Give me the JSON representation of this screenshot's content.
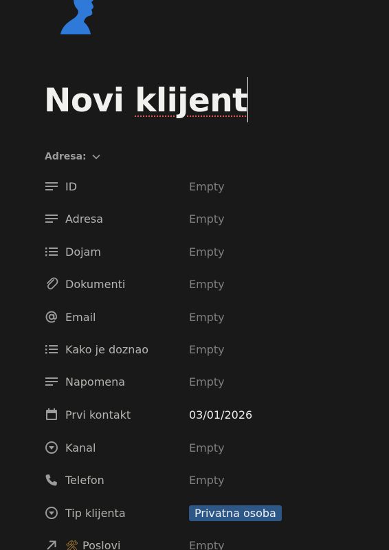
{
  "page": {
    "title_part1": "Novi ",
    "title_part2": "klijent"
  },
  "section": {
    "label": "Adresa:",
    "toggle_icon": "chevron-down-icon"
  },
  "properties": [
    {
      "label": "ID",
      "value": "Empty",
      "icon": "text-lines-icon"
    },
    {
      "label": "Adresa",
      "value": "Empty",
      "icon": "text-lines-icon"
    },
    {
      "label": "Dojam",
      "value": "Empty",
      "icon": "list-icon"
    },
    {
      "label": "Dokumenti",
      "value": "Empty",
      "icon": "paperclip-icon"
    },
    {
      "label": "Email",
      "value": "Empty",
      "icon": "at-icon"
    },
    {
      "label": "Kako je doznao",
      "value": "Empty",
      "icon": "list-icon"
    },
    {
      "label": "Napomena",
      "value": "Empty",
      "icon": "text-lines-icon"
    },
    {
      "label": "Prvi kontakt",
      "value": "03/01/2026",
      "icon": "calendar-icon"
    },
    {
      "label": "Kanal",
      "value": "Empty",
      "icon": "select-icon"
    },
    {
      "label": "Telefon",
      "value": "Empty",
      "icon": "phone-icon"
    },
    {
      "label": "Tip klijenta",
      "value": "Privatna osoba",
      "icon": "select-icon"
    },
    {
      "label": "Poslovi",
      "value": "Empty",
      "icon": "relation-arrow-icon",
      "emoji": "🛠"
    }
  ],
  "colors": {
    "background": "#191919",
    "tag_background": "#2c5786",
    "avatar": "#2f7ad8"
  }
}
